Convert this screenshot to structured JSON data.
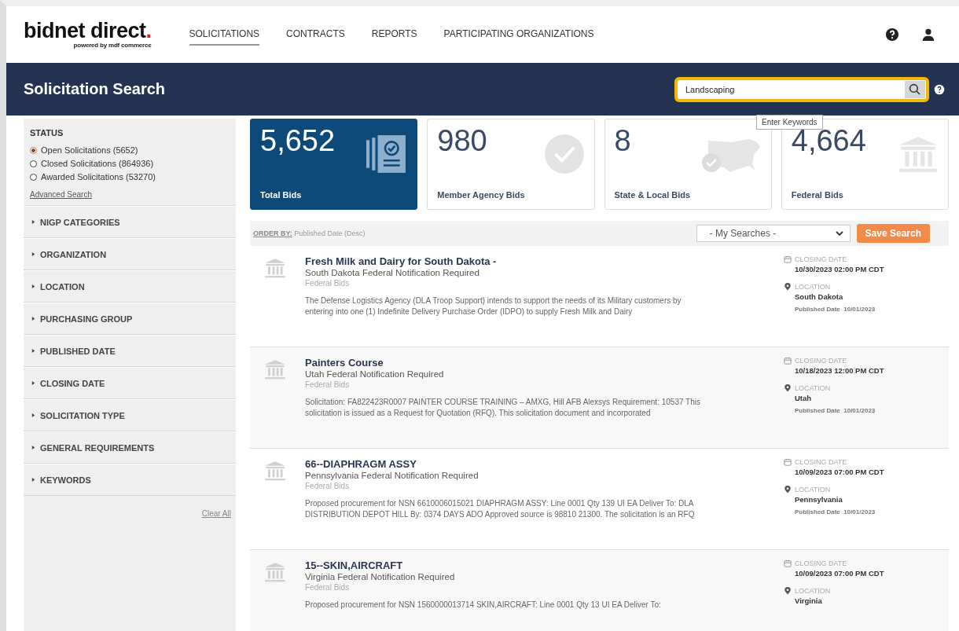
{
  "logo": {
    "name": "bidnet direct",
    "dot": ".",
    "tagline": "powered by mdf commerce"
  },
  "nav": [
    {
      "label": "SOLICITATIONS",
      "selected": true
    },
    {
      "label": "CONTRACTS",
      "selected": false
    },
    {
      "label": "REPORTS",
      "selected": false
    },
    {
      "label": "PARTICIPATING ORGANIZATIONS",
      "selected": false
    }
  ],
  "banner": {
    "title": "Solicitation Search",
    "search_value": "Landscaping",
    "tooltip": "Enter Keywords"
  },
  "sidebar": {
    "status_title": "STATUS",
    "statuses": [
      {
        "label": "Open Solicitations (5652)",
        "selected": true
      },
      {
        "label": "Closed Solicitations (864936)",
        "selected": false
      },
      {
        "label": "Awarded Solicitations (53270)",
        "selected": false
      }
    ],
    "advanced_link": "Advanced Search",
    "filters": [
      {
        "label": "NIGP CATEGORIES",
        "expanded": false
      },
      {
        "label": "ORGANIZATION",
        "expanded": false
      },
      {
        "label": "LOCATION",
        "expanded": false
      },
      {
        "label": "PURCHASING GROUP",
        "expanded": false
      },
      {
        "label": "PUBLISHED DATE",
        "expanded": false
      },
      {
        "label": "CLOSING DATE",
        "expanded": false
      },
      {
        "label": "SOLICITATION TYPE",
        "expanded": false
      },
      {
        "label": "GENERAL REQUIREMENTS",
        "expanded": false
      },
      {
        "label": "KEYWORDS",
        "expanded": false
      }
    ],
    "clear_link": "Clear All"
  },
  "stats": [
    {
      "value": "5,652",
      "label": "Total Bids",
      "kind": "document",
      "selected": true
    },
    {
      "value": "980",
      "label": "Member Agency Bids",
      "kind": "check",
      "selected": false
    },
    {
      "value": "8",
      "label": "State & Local Bids",
      "kind": "map",
      "selected": false
    },
    {
      "value": "4,664",
      "label": "Federal Bids",
      "kind": "building",
      "selected": false
    }
  ],
  "toolbar": {
    "order_label": "ORDER BY:",
    "order_value": "Published Date (Desc)",
    "my_searches": "- My Searches -",
    "save_button": "Save Search"
  },
  "results": [
    {
      "title": "Fresh Milk and Dairy for South Dakota -",
      "subtitle": "South Dakota Federal Notification Required",
      "category": "Federal Bids",
      "description": "The Defense Logistics Agency (DLA Troop Support) intends to support the needs of its Military customers by entering into one (1) Indefinite Delivery Purchase Order (IDPO) to supply Fresh Milk and Dairy",
      "closing_label": "CLOSING DATE",
      "closing_date": "10/30/2023 02:00 PM CDT",
      "location_label": "LOCATION",
      "location": "South Dakota",
      "published": "Published Date  10/01/2023"
    },
    {
      "title": "Painters Course",
      "subtitle": "Utah Federal Notification Required",
      "category": "Federal Bids",
      "description": "Solicitation: FA822423R0007  PAINTER COURSE TRAINING – AMXG, Hill AFB Alexsys Requirement: 10537 This solicitation is issued as a Request for Quotation (RFQ). This solicitation document and incorporated",
      "closing_label": "CLOSING DATE",
      "closing_date": "10/18/2023 12:00 PM CDT",
      "location_label": "LOCATION",
      "location": "Utah",
      "published": "Published Date  10/01/2023"
    },
    {
      "title": "66--DIAPHRAGM ASSY",
      "subtitle": "Pennsylvania Federal Notification Required",
      "category": "Federal Bids",
      "description": "Proposed procurement for NSN 6610006015021 DIAPHRAGM ASSY: Line 0001 Qty 139 UI EA Deliver To: DLA DISTRIBUTION DEPOT HILL By: 0374 DAYS ADO Approved source is 98810 21300. The solicitation is an RFQ",
      "closing_label": "CLOSING DATE",
      "closing_date": "10/09/2023 07:00 PM CDT",
      "location_label": "LOCATION",
      "location": "Pennsylvania",
      "published": "Published Date  10/01/2023"
    },
    {
      "title": "15--SKIN,AIRCRAFT",
      "subtitle": "Virginia Federal Notification Required",
      "category": "Federal Bids",
      "description": "Proposed procurement for NSN 1560000013714 SKIN,AIRCRAFT: Line 0001 Qty 13 UI EA Deliver To:",
      "closing_label": "CLOSING DATE",
      "closing_date": "10/09/2023 07:00 PM CDT",
      "location_label": "LOCATION",
      "location": "Virginia"
    }
  ]
}
